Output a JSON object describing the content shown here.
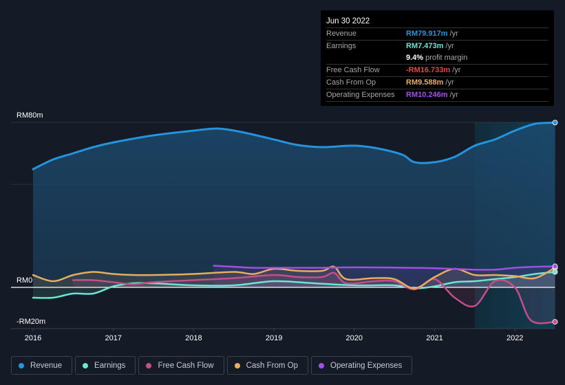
{
  "tooltip": {
    "date": "Jun 30 2022",
    "rows": [
      {
        "label": "Revenue",
        "value": "RM79.917m",
        "unit": "/yr",
        "color": "#2394df"
      },
      {
        "label": "Earnings",
        "value": "RM7.473m",
        "unit": "/yr",
        "color": "#6ce5d4"
      },
      {
        "label": "",
        "value": "9.4%",
        "unit": "profit margin",
        "color": "#ffffff"
      },
      {
        "label": "Free Cash Flow",
        "value": "-RM16.733m",
        "unit": "/yr",
        "color": "#e64545"
      },
      {
        "label": "Cash From Op",
        "value": "RM9.588m",
        "unit": "/yr",
        "color": "#e8ae5f"
      },
      {
        "label": "Operating Expenses",
        "value": "RM10.246m",
        "unit": "/yr",
        "color": "#a44ee8"
      }
    ]
  },
  "legend": [
    {
      "label": "Revenue",
      "color": "#2394df"
    },
    {
      "label": "Earnings",
      "color": "#6ce5d4"
    },
    {
      "label": "Free Cash Flow",
      "color": "#c44f8a"
    },
    {
      "label": "Cash From Op",
      "color": "#e8ae5f"
    },
    {
      "label": "Operating Expenses",
      "color": "#a44ee8"
    }
  ],
  "chart_data": {
    "type": "line",
    "title": "",
    "xlabel": "",
    "ylabel": "",
    "ylim": [
      -20,
      80
    ],
    "xlim": [
      2016.0,
      2022.5
    ],
    "y_ticks": [
      {
        "value": 80,
        "label": "RM80m"
      },
      {
        "value": 0,
        "label": "RM0"
      },
      {
        "value": -20,
        "label": "-RM20m"
      }
    ],
    "x_ticks": [
      {
        "value": 2016,
        "label": "2016"
      },
      {
        "value": 2017,
        "label": "2017"
      },
      {
        "value": 2018,
        "label": "2018"
      },
      {
        "value": 2019,
        "label": "2019"
      },
      {
        "value": 2020,
        "label": "2020"
      },
      {
        "value": 2021,
        "label": "2021"
      },
      {
        "value": 2022,
        "label": "2022"
      }
    ],
    "highlight_from": 2021.5,
    "series": [
      {
        "name": "Revenue",
        "color": "#2394df",
        "fill": true,
        "x": [
          2016.0,
          2016.25,
          2016.5,
          2016.75,
          2017.0,
          2017.5,
          2018.0,
          2018.3,
          2018.6,
          2019.0,
          2019.3,
          2019.6,
          2020.0,
          2020.3,
          2020.6,
          2020.75,
          2021.0,
          2021.25,
          2021.5,
          2021.75,
          2022.0,
          2022.25,
          2022.5
        ],
        "values": [
          57.3,
          62,
          65,
          68,
          70.3,
          73.7,
          76,
          77,
          75.3,
          71.7,
          69,
          68,
          68.7,
          67.3,
          64.3,
          60.7,
          60.7,
          63.3,
          68.7,
          71.7,
          76,
          79.3,
          79.9
        ]
      },
      {
        "name": "Earnings",
        "color": "#6ce5d4",
        "fill": false,
        "x": [
          2016.0,
          2016.25,
          2016.5,
          2016.75,
          2017.0,
          2017.25,
          2017.5,
          2018.0,
          2018.5,
          2019.0,
          2019.5,
          2020.0,
          2020.5,
          2020.75,
          2021.0,
          2021.25,
          2021.5,
          2021.75,
          2022.0,
          2022.25,
          2022.5
        ],
        "values": [
          -5,
          -5,
          -3,
          -3,
          0.5,
          2,
          2,
          1,
          1,
          3,
          2,
          1,
          1,
          -0.5,
          0.5,
          2.5,
          3,
          4,
          5,
          6.5,
          7.5
        ]
      },
      {
        "name": "Free Cash Flow",
        "color": "#c44f8a",
        "fill": false,
        "x": [
          2016.5,
          2016.75,
          2017.0,
          2017.25,
          2017.5,
          2018.0,
          2018.5,
          2019.0,
          2019.3,
          2019.6,
          2019.75,
          2019.9,
          2020.25,
          2020.5,
          2020.75,
          2021.0,
          2021.25,
          2021.5,
          2021.75,
          2022.0,
          2022.2,
          2022.5
        ],
        "values": [
          3.5,
          3.5,
          2.5,
          1.5,
          2.5,
          3.5,
          4.5,
          6,
          5,
          5,
          7,
          2,
          3,
          3,
          -1,
          4,
          -5,
          -9,
          3,
          0,
          -16,
          -16.7
        ]
      },
      {
        "name": "Cash From Op",
        "color": "#e8ae5f",
        "fill": false,
        "x": [
          2016.0,
          2016.25,
          2016.5,
          2016.75,
          2017.0,
          2017.25,
          2017.5,
          2018.0,
          2018.5,
          2018.75,
          2019.0,
          2019.3,
          2019.6,
          2019.75,
          2019.9,
          2020.25,
          2020.5,
          2020.75,
          2021.0,
          2021.25,
          2021.5,
          2021.75,
          2022.0,
          2022.25,
          2022.5
        ],
        "values": [
          6,
          3,
          6,
          7.5,
          6.5,
          6,
          6,
          6.5,
          7.5,
          6.5,
          9,
          8,
          8,
          10,
          4,
          4.5,
          4,
          -0.5,
          5,
          9,
          6,
          6,
          5.5,
          4.5,
          9.6
        ]
      },
      {
        "name": "Operating Expenses",
        "color": "#a44ee8",
        "fill": false,
        "x": [
          2018.25,
          2018.5,
          2018.75,
          2019.0,
          2019.5,
          2020.0,
          2020.5,
          2021.0,
          2021.5,
          2021.75,
          2022.0,
          2022.25,
          2022.5
        ],
        "values": [
          10.5,
          10,
          9.5,
          9.5,
          9.5,
          9.7,
          9.6,
          9.3,
          8.6,
          8.6,
          9.5,
          10,
          10.2
        ]
      }
    ]
  }
}
